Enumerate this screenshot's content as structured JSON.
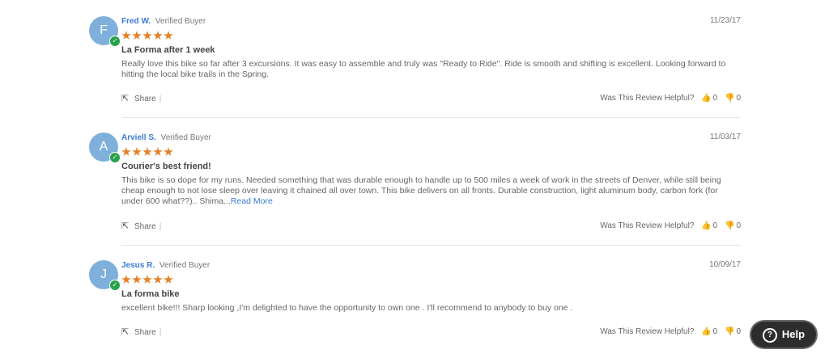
{
  "reviews": [
    {
      "initial": "F",
      "author": "Fred W.",
      "verified": "Verified Buyer",
      "date": "11/23/17",
      "rating": 5,
      "title": "La Forma after 1 week",
      "body": "Really love this bike so far after 3 excursions. It was easy to assemble and truly was \"Ready to Ride\". Ride is smooth and shifting is excellent. Looking forward to hitting the local bike trails in the Spring.",
      "read_more": "",
      "share": "Share",
      "sep": "|",
      "helpful": "Was This Review Helpful?",
      "up": "0",
      "down": "0"
    },
    {
      "initial": "A",
      "author": "Arviell S.",
      "verified": "Verified Buyer",
      "date": "11/03/17",
      "rating": 5,
      "title": "Courier's best friend!",
      "body": "This bike is so dope for my runs. Needed something that was durable enough to handle up to 500 miles a week of work in the streets of Denver, while still being cheap enough to not lose sleep over leaving it chained all over town. This bike delivers on all fronts. Durable construction, light aluminum body, carbon fork (for under 600 what??).. Shima...",
      "read_more": "Read More",
      "share": "Share",
      "sep": "|",
      "helpful": "Was This Review Helpful?",
      "up": "0",
      "down": "0"
    },
    {
      "initial": "J",
      "author": "Jesus R.",
      "verified": "Verified Buyer",
      "date": "10/09/17",
      "rating": 5,
      "title": "La forma bike",
      "body": "excellent bike!!! Sharp looking ,I'm delighted to have the opportunity to own one . I'll recommend to anybody to buy one .",
      "read_more": "",
      "share": "Share",
      "sep": "|",
      "helpful": "Was This Review Helpful?",
      "up": "0",
      "down": "0"
    }
  ],
  "help_button": {
    "label": "Help",
    "icon": "question-icon"
  },
  "colors": {
    "star": "#e67e22",
    "author": "#3a7bd5",
    "avatar": "#7fb0dc",
    "check": "#27a24a"
  }
}
